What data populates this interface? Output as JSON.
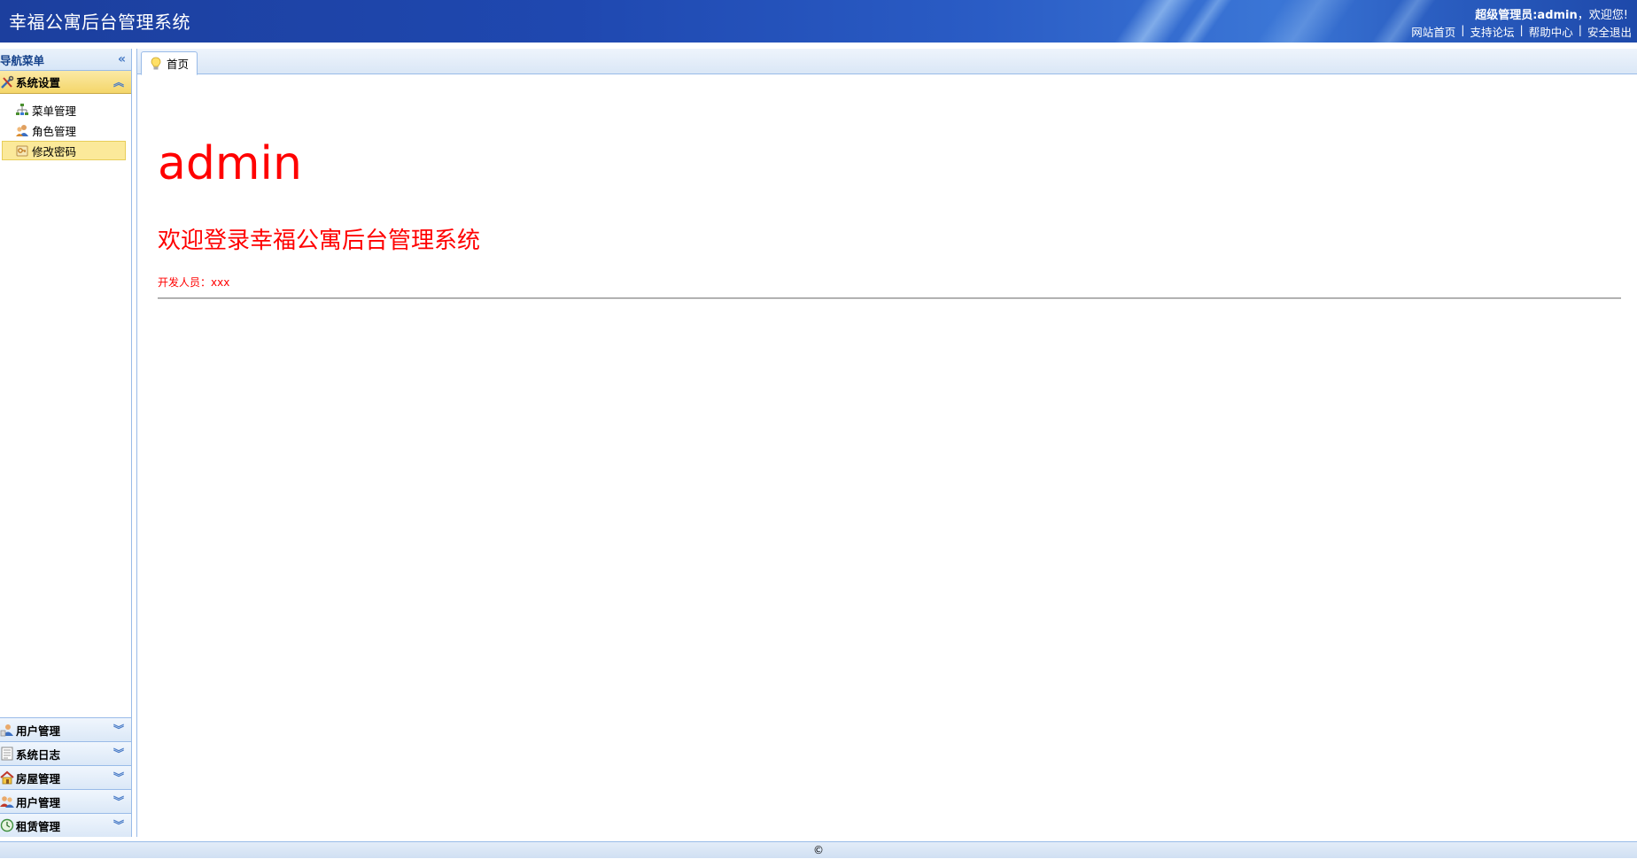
{
  "header": {
    "title": "幸福公寓后台管理系统",
    "user_role": "超级管理员:admin",
    "welcome": "，欢迎您!",
    "links": [
      "网站首页",
      "支持论坛",
      "帮助中心",
      "安全退出"
    ],
    "separator": "|"
  },
  "sidebar": {
    "title": "导航菜单",
    "open_panel": {
      "label": "系统设置",
      "icon": "tools-icon",
      "items": [
        {
          "label": "菜单管理",
          "icon": "sitemap-icon"
        },
        {
          "label": "角色管理",
          "icon": "users-icon"
        },
        {
          "label": "修改密码",
          "icon": "key-icon",
          "selected": true
        }
      ]
    },
    "closed_panels": [
      {
        "label": "用户管理",
        "icon": "user-icon"
      },
      {
        "label": "系统日志",
        "icon": "log-icon"
      },
      {
        "label": "房屋管理",
        "icon": "house-icon"
      },
      {
        "label": "用户管理",
        "icon": "users-group-icon"
      },
      {
        "label": "租赁管理",
        "icon": "clock-icon"
      }
    ]
  },
  "tabs": [
    {
      "label": "首页",
      "icon": "lightbulb-icon",
      "active": true
    }
  ],
  "content": {
    "username": "admin",
    "welcome_text": "欢迎登录幸福公寓后台管理系统",
    "developer": "开发人员：xxx",
    "text_color": "#ff0000"
  },
  "footer": {
    "copyright": "©"
  }
}
